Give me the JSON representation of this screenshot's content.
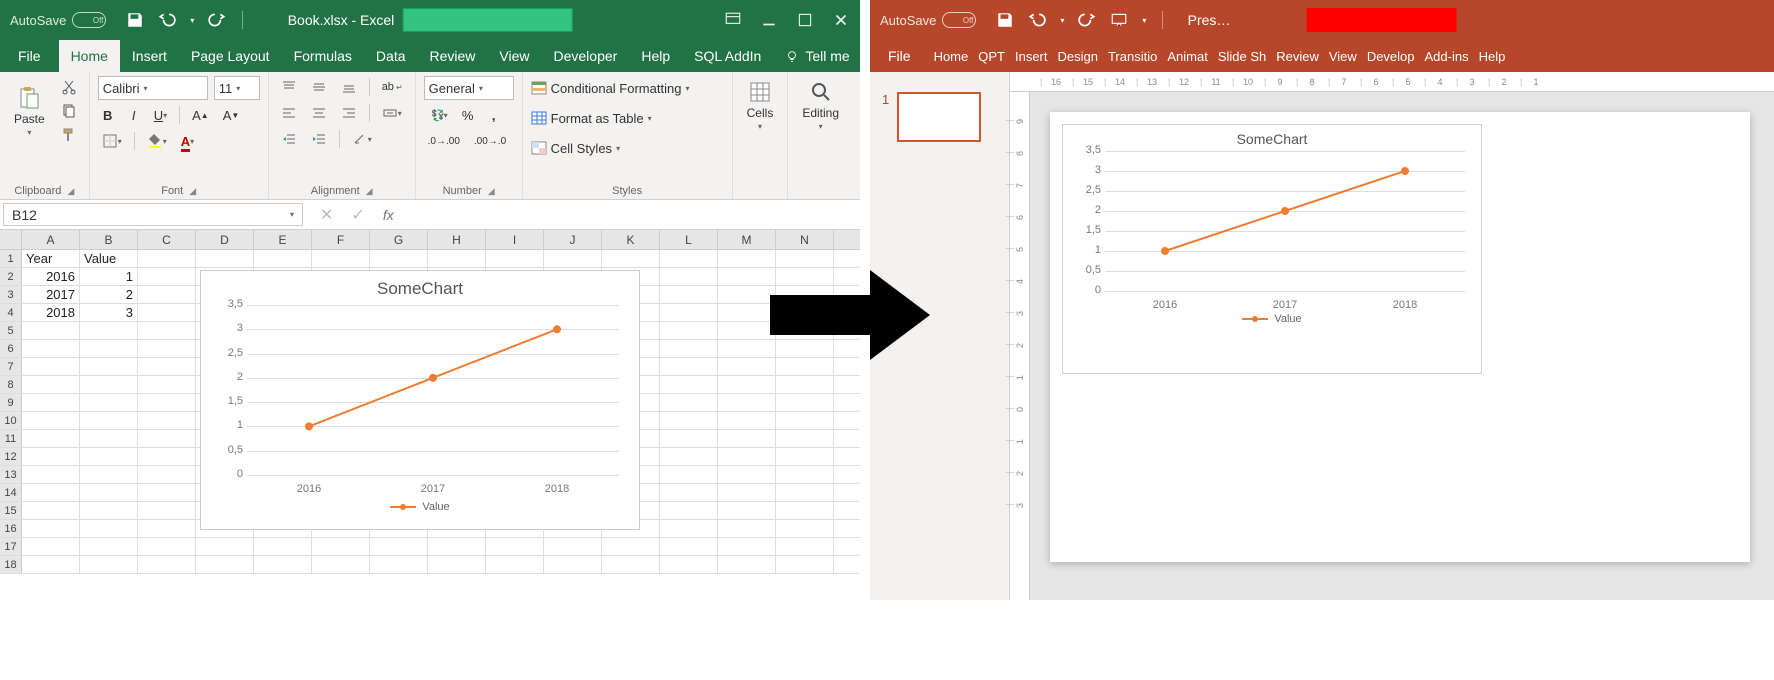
{
  "excel": {
    "titlebar": {
      "autosave": "AutoSave",
      "autosave_state": "Off",
      "title": "Book.xlsx  -  Excel"
    },
    "tabs": [
      "File",
      "Home",
      "Insert",
      "Page Layout",
      "Formulas",
      "Data",
      "Review",
      "View",
      "Developer",
      "Help",
      "SQL AddIn"
    ],
    "active_tab": "Home",
    "tell_me": "Tell me",
    "ribbon": {
      "clipboard": {
        "label": "Clipboard",
        "paste": "Paste"
      },
      "font": {
        "label": "Font",
        "name": "Calibri",
        "size": "11"
      },
      "alignment": {
        "label": "Alignment",
        "wrap": "ab"
      },
      "number": {
        "label": "Number",
        "format": "General"
      },
      "styles": {
        "label": "Styles",
        "cond": "Conditional Formatting",
        "table": "Format as Table",
        "cell": "Cell Styles"
      },
      "cells": {
        "label": "Cells"
      },
      "editing": {
        "label": "Editing"
      }
    },
    "namebox": "B12",
    "sheet": {
      "cols": [
        "A",
        "B",
        "C",
        "D",
        "E",
        "F",
        "G",
        "H",
        "I",
        "J",
        "K",
        "L",
        "M",
        "N"
      ],
      "rownums": [
        1,
        2,
        3,
        4,
        5,
        6,
        7,
        8,
        9,
        10,
        11,
        12,
        13,
        14,
        15,
        16,
        17,
        18
      ],
      "headers": {
        "A": "Year",
        "B": "Value"
      },
      "data": [
        {
          "A": "2016",
          "B": "1"
        },
        {
          "A": "2017",
          "B": "2"
        },
        {
          "A": "2018",
          "B": "3"
        }
      ]
    }
  },
  "ppt": {
    "titlebar": {
      "autosave": "AutoSave",
      "autosave_state": "Off",
      "title": "Pres…"
    },
    "tabs": [
      "File",
      "Home",
      "QPT",
      "Insert",
      "Design",
      "Transitio",
      "Animat",
      "Slide Sh",
      "Review",
      "View",
      "Develop",
      "Add-ins",
      "Help"
    ],
    "thumb_num": "1",
    "h_ruler": [
      "16",
      "15",
      "14",
      "13",
      "12",
      "11",
      "10",
      "9",
      "8",
      "7",
      "6",
      "5",
      "4",
      "3",
      "2",
      "1"
    ],
    "v_ruler": [
      "9",
      "8",
      "7",
      "6",
      "5",
      "4",
      "3",
      "2",
      "1",
      "0",
      "1",
      "2",
      "3"
    ]
  },
  "chart_data": {
    "type": "line",
    "title": "SomeChart",
    "categories": [
      "2016",
      "2017",
      "2018"
    ],
    "series": [
      {
        "name": "Value",
        "values": [
          1,
          2,
          3
        ]
      }
    ],
    "ylim": [
      0,
      3.5
    ],
    "yticks": [
      0,
      0.5,
      1,
      1.5,
      2,
      2.5,
      3,
      3.5
    ],
    "ytick_labels": [
      "0",
      "0,5",
      "1",
      "1,5",
      "2",
      "2,5",
      "3",
      "3,5"
    ],
    "color": "#ED7D31"
  }
}
